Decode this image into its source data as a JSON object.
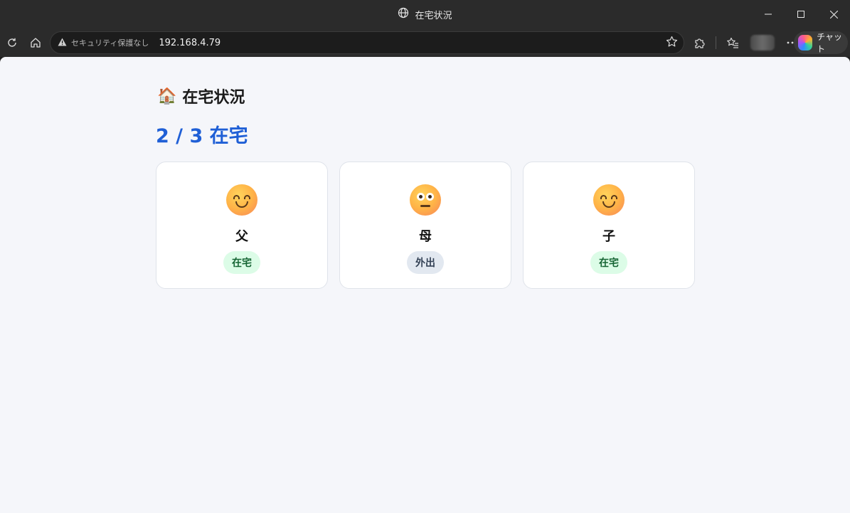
{
  "window": {
    "title": "在宅状況"
  },
  "toolbar": {
    "security_label": "セキュリティ保護なし",
    "url": "192.168.4.79",
    "chat_label": "チャット"
  },
  "page": {
    "title_icon": "🏠",
    "title": "在宅状況",
    "summary": "2 / 3 在宅",
    "members": [
      {
        "name": "父",
        "status": "在宅",
        "status_key": "home",
        "face": "smile"
      },
      {
        "name": "母",
        "status": "外出",
        "status_key": "away",
        "face": "neutral"
      },
      {
        "name": "子",
        "status": "在宅",
        "status_key": "home",
        "face": "smile"
      }
    ]
  },
  "colors": {
    "summary": "#1f5fd6",
    "home_badge_bg": "#dcfce7",
    "home_badge_text": "#166534",
    "away_badge_bg": "#e2e8f0",
    "away_badge_text": "#334155"
  }
}
